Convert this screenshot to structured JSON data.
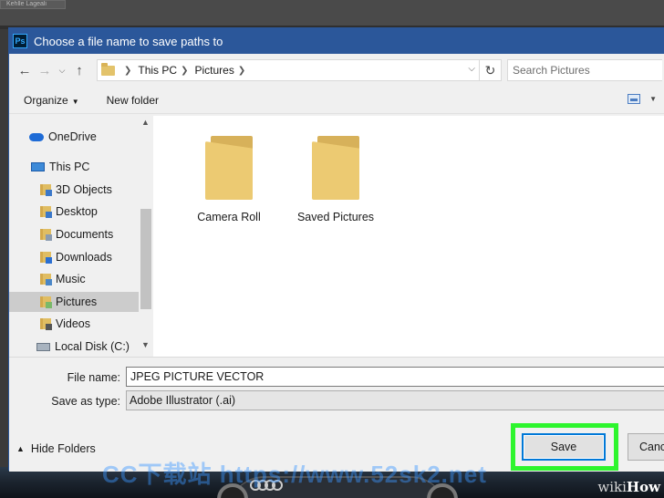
{
  "background": {
    "tab_label": "Kehlle Lageali",
    "watermark": "CC下载站 https://www.52sk2.net",
    "brand_prefix": "wiki",
    "brand_suffix": "How"
  },
  "dialog": {
    "title": "Choose a file name to save paths to",
    "app_icon_text": "Ps"
  },
  "address": {
    "crumbs": [
      "This PC",
      "Pictures"
    ],
    "search_placeholder": "Search Pictures"
  },
  "toolbar": {
    "organize_label": "Organize",
    "new_folder_label": "New folder"
  },
  "sidebar": {
    "items": [
      {
        "label": "OneDrive",
        "icon": "cloud-icon"
      },
      {
        "label": "This PC",
        "icon": "computer-icon"
      },
      {
        "label": "3D Objects",
        "icon": "folder-3d-icon"
      },
      {
        "label": "Desktop",
        "icon": "folder-desktop-icon"
      },
      {
        "label": "Documents",
        "icon": "folder-documents-icon"
      },
      {
        "label": "Downloads",
        "icon": "folder-downloads-icon"
      },
      {
        "label": "Music",
        "icon": "folder-music-icon"
      },
      {
        "label": "Pictures",
        "icon": "folder-pictures-icon",
        "selected": true
      },
      {
        "label": "Videos",
        "icon": "folder-videos-icon"
      },
      {
        "label": "Local Disk (C:)",
        "icon": "disk-icon"
      }
    ]
  },
  "content": {
    "folders": [
      {
        "label": "Camera Roll"
      },
      {
        "label": "Saved Pictures"
      }
    ]
  },
  "fields": {
    "file_name_label": "File name:",
    "file_name_value": "JPEG PICTURE VECTOR",
    "save_type_label": "Save as type:",
    "save_type_value": "Adobe Illustrator (.ai)"
  },
  "footer": {
    "hide_folders_label": "Hide Folders",
    "save_label": "Save",
    "cancel_label": "Canc"
  },
  "colors": {
    "titlebar": "#2b579a",
    "highlight": "#2df52d",
    "focus_border": "#0078d7"
  }
}
